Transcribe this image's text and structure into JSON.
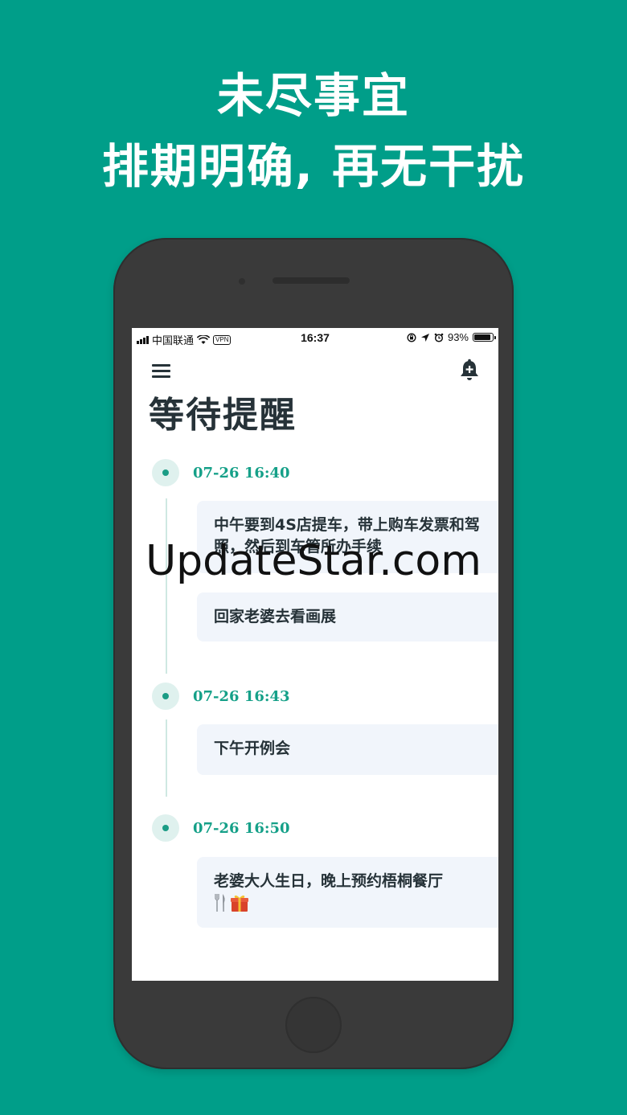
{
  "promo": {
    "line1": "未尽事宜",
    "line2": "排期明确, 再无干扰"
  },
  "status_bar": {
    "carrier": "中国联通",
    "vpn": "VPN",
    "time": "16:37",
    "battery_percent": "93%",
    "battery_level": 0.93
  },
  "header": {
    "menu_icon": "hamburger-menu-icon",
    "add_reminder_icon": "bell-plus-icon"
  },
  "page_title": "等待提醒",
  "groups": [
    {
      "time": "07-26 16:40",
      "items": [
        {
          "text": "中午要到4S店提车，带上购车发票和驾照，然后到车管所办手续"
        },
        {
          "text": "回家老婆去看画展"
        }
      ]
    },
    {
      "time": "07-26 16:43",
      "items": [
        {
          "text": "下午开例会"
        }
      ]
    },
    {
      "time": "07-26 16:50",
      "items": [
        {
          "text": "老婆大人生日，晚上预约梧桐餐厅",
          "emojis": [
            "fork-knife-icon",
            "gift-icon"
          ]
        }
      ]
    }
  ],
  "watermark": "UpdateStar.com",
  "colors": {
    "background": "#009e89",
    "accent": "#15a088",
    "card": "#f1f5fb",
    "text_dark": "#263238"
  }
}
